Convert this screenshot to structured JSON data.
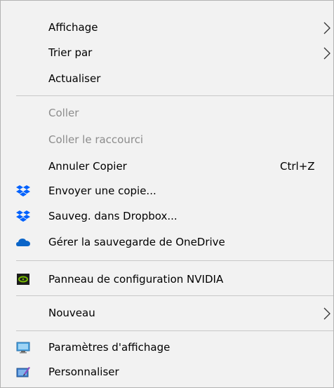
{
  "menu": {
    "items": [
      {
        "label": "Affichage",
        "submenu": true,
        "icon": null,
        "disabled": false
      },
      {
        "label": "Trier par",
        "submenu": true,
        "icon": null,
        "disabled": false
      },
      {
        "label": "Actualiser",
        "submenu": false,
        "icon": null,
        "disabled": false
      },
      {
        "label": "Coller",
        "submenu": false,
        "icon": null,
        "disabled": true
      },
      {
        "label": "Coller le raccourci",
        "submenu": false,
        "icon": null,
        "disabled": true
      },
      {
        "label": "Annuler Copier",
        "shortcut": "Ctrl+Z",
        "submenu": false,
        "icon": null,
        "disabled": false
      },
      {
        "label": "Envoyer une copie...",
        "submenu": false,
        "icon": "dropbox-icon",
        "disabled": false
      },
      {
        "label": "Sauveg. dans Dropbox...",
        "submenu": false,
        "icon": "dropbox-icon",
        "disabled": false
      },
      {
        "label": "Gérer la sauvegarde de OneDrive",
        "submenu": false,
        "icon": "onedrive-cloud-icon",
        "disabled": false
      },
      {
        "label": "Panneau de configuration NVIDIA",
        "submenu": false,
        "icon": "nvidia-icon",
        "disabled": false
      },
      {
        "label": "Nouveau",
        "submenu": true,
        "icon": null,
        "disabled": false
      },
      {
        "label": "Paramètres d'affichage",
        "submenu": false,
        "icon": "display-settings-icon",
        "disabled": false
      },
      {
        "label": "Personnaliser",
        "submenu": false,
        "icon": "personalize-icon",
        "disabled": false
      }
    ]
  },
  "colors": {
    "background": "#f2f2f2",
    "text": "#000000",
    "disabled_text": "#8c8c8c",
    "separator": "#c8c8c8",
    "dropbox": "#0061fe",
    "onedrive": "#0a64c8",
    "nvidia": "#76b900"
  }
}
